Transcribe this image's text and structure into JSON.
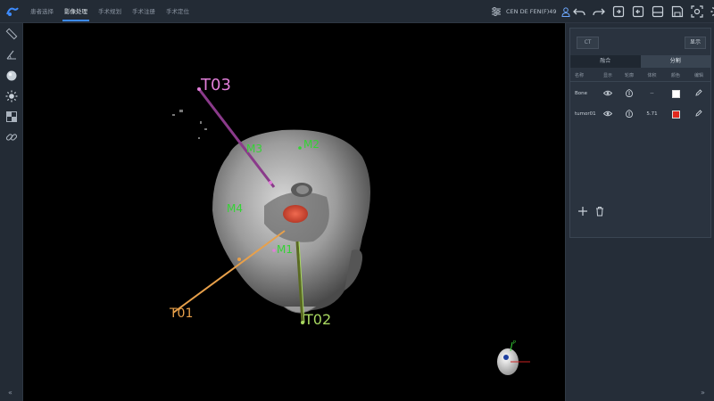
{
  "topbar": {
    "tabs": [
      {
        "label": "患者选择"
      },
      {
        "label": "影像处理"
      },
      {
        "label": "手术规划"
      },
      {
        "label": "手术注册"
      },
      {
        "label": "手术定位"
      }
    ],
    "active_tab_index": 1,
    "user_name": "CEN DE FEN(F)49",
    "toolbar_icons": [
      "undo-icon",
      "redo-icon",
      "import-icon",
      "export-icon",
      "layout-icon",
      "save-icon",
      "screenshot-icon",
      "settings-icon"
    ]
  },
  "left_toolbar": {
    "icons": [
      "ruler-icon",
      "angle-icon",
      "sphere-icon",
      "brightness-icon",
      "window-level-icon",
      "link-icon"
    ]
  },
  "viewport": {
    "trajectories": [
      {
        "label": "T03",
        "color": "#e07ed8"
      },
      {
        "label": "T01",
        "color": "#e8a04a"
      },
      {
        "label": "T02",
        "color": "#a8d860"
      }
    ],
    "markers": [
      {
        "label": "M3"
      },
      {
        "label": "M2"
      },
      {
        "label": "M4"
      },
      {
        "label": "M1"
      }
    ],
    "marker_color": "#35d335",
    "orientation_label": "P"
  },
  "right_panel": {
    "ct_button": "CT",
    "show_button": "显示",
    "segment_tabs": [
      {
        "label": "融合"
      },
      {
        "label": "分割"
      }
    ],
    "active_segment_tab_index": 1,
    "table_headers": [
      "名称",
      "显示",
      "轮廓",
      "体积",
      "颜色",
      "编辑"
    ],
    "rows": [
      {
        "name": "Bone",
        "volume": "--",
        "color": "#ffffff"
      },
      {
        "name": "tumor01",
        "volume": "5.71",
        "color": "#e0281e"
      }
    ]
  },
  "footer": {
    "collapse_left": "«",
    "collapse_right": "»"
  }
}
